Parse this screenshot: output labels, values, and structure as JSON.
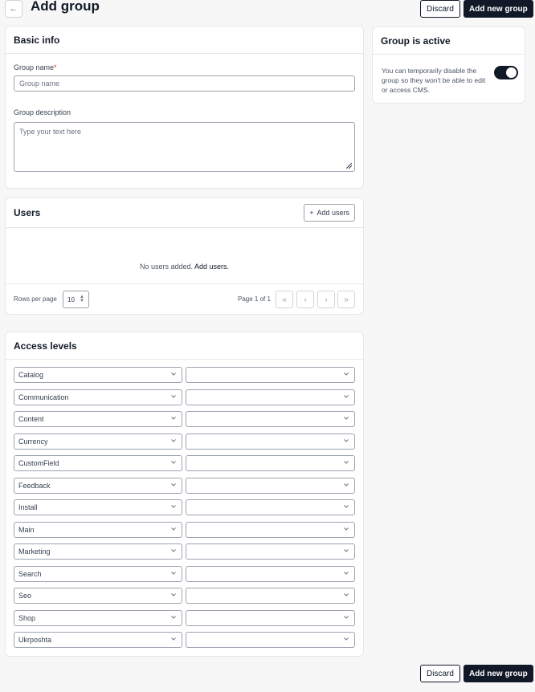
{
  "header": {
    "title": "Add group",
    "back_icon": "arrow-left-icon",
    "discard_label": "Discard",
    "submit_label": "Add new group"
  },
  "basic_info": {
    "title": "Basic info",
    "name_label": "Group name",
    "name_required_mark": "*",
    "name_placeholder": "Group name",
    "description_label": "Group description",
    "description_placeholder": "Type your text here"
  },
  "group_active": {
    "title": "Group is active",
    "description": "You can temporarily disable the group so they won't be able to edit or access CMS.",
    "enabled": true
  },
  "users": {
    "title": "Users",
    "add_button_icon": "plus-icon",
    "add_button_label": "Add users",
    "empty_text": "No users added.",
    "empty_link": "Add users.",
    "rows_per_page_label": "Rows per page",
    "rows_per_page_value": "10",
    "page_info": "Page 1 of 1"
  },
  "access_levels": {
    "title": "Access levels",
    "items": [
      {
        "module": "Catalog",
        "level": ""
      },
      {
        "module": "Communication",
        "level": ""
      },
      {
        "module": "Content",
        "level": ""
      },
      {
        "module": "Currency",
        "level": ""
      },
      {
        "module": "CustomField",
        "level": ""
      },
      {
        "module": "Feedback",
        "level": ""
      },
      {
        "module": "Install",
        "level": ""
      },
      {
        "module": "Main",
        "level": ""
      },
      {
        "module": "Marketing",
        "level": ""
      },
      {
        "module": "Search",
        "level": ""
      },
      {
        "module": "Seo",
        "level": ""
      },
      {
        "module": "Shop",
        "level": ""
      },
      {
        "module": "Ukrposhta",
        "level": ""
      }
    ]
  },
  "footer": {
    "discard_label": "Discard",
    "submit_label": "Add new group"
  },
  "colors": {
    "primary": "#111827",
    "required": "#dc2626",
    "border": "#e5e7eb"
  }
}
